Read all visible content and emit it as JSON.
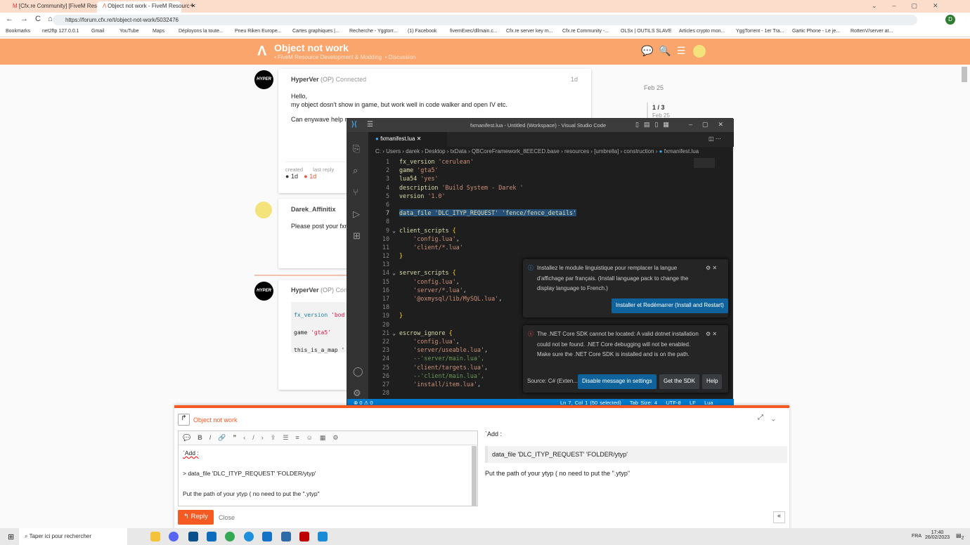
{
  "browser": {
    "tabs": [
      {
        "label": "[Cfx.re Community] [FiveM Resou"
      },
      {
        "label": "Object not work - FiveM Resourc"
      }
    ],
    "url": "https://forum.cfx.re/t/object-not-work/5032476",
    "bookmarks": [
      "Bookmarks",
      "net2ftp 127.0.0.1",
      "Gmail",
      "YouTube",
      "Maps",
      "Déployons la toute...",
      "Pneu Riken Europe...",
      "Cartes graphiques |...",
      "Recherche - Yggtorr...",
      "(1) Facebook",
      "fivemExec/dllmain.c...",
      "Cfx.re server key m...",
      "Cfx.re Community -...",
      "OLSx | OUTILS SLAVE",
      "Articles crypto mon...",
      "YggTorrent - 1er Tra...",
      "Gartic Phone - Le je...",
      "RottenV/server at..."
    ],
    "profile_initial": "D"
  },
  "forum": {
    "title": "Object not work",
    "category": "FiveM Resource Development & Modding",
    "subcategory": "Discussion",
    "timeline": {
      "start": "Feb 25",
      "position": "1 / 3",
      "date": "Feb 25"
    },
    "posts": [
      {
        "avatar": "HYPER",
        "user": "HyperVer",
        "op": "(OP)",
        "status": "Connected",
        "age": "1d",
        "lines": [
          "Hello,",
          "my object dosn't show in game, but work well in code walker and open IV etc.",
          "Can enywave help m"
        ],
        "created_label": "created",
        "created": "1d",
        "last_reply_label": "last reply",
        "last_reply": "1d"
      },
      {
        "user": "Darek_Affinitix",
        "text": "Please post your fxm"
      },
      {
        "avatar": "HYPER",
        "user": "HyperVer",
        "op": "(OP)",
        "status": "Conn",
        "code": [
          "fx_version",
          "'bod",
          "game",
          "'gta5'",
          "this_is_a_map",
          "'"
        ]
      }
    ]
  },
  "vscode": {
    "title": "fxmanifest.lua - Untitled (Workspace) - Visual Studio Code",
    "tab": "fxmanifest.lua",
    "breadcrumb": "C: › Users › darek › Desktop › txData › QBCoreFramework_8EECED.base › resources › [umbrella] › construction › ",
    "breadcrumb_file": "fxmanifest.lua",
    "notifications": [
      {
        "text": "Installez le module linguistique pour remplacer la langue d'affichage par français. (Install language pack to change the display language to French.)",
        "button": "Installer et Redémarrer (Install and Restart)"
      },
      {
        "text": "The .NET Core SDK cannot be located: A valid dotnet installation could not be found. .NET Core debugging will not be enabled. Make sure the .NET Core SDK is installed and is on the path.",
        "source": "Source: C# (Exten...",
        "buttons": [
          "Disable message in settings",
          "Get the SDK",
          "Help"
        ]
      }
    ],
    "status": {
      "problems": "⊗ 0 ⚠ 0",
      "position": "Ln 7, Col 1 (50 selected)",
      "tab_size": "Tab Size: 4",
      "encoding": "UTF-8",
      "eol": "LF",
      "language": "Lua"
    }
  },
  "composer": {
    "reply_to": "Object not work",
    "editor_lines": [
      "`Add :",
      "> data_file 'DLC_ITYP_REQUEST' 'FOLDER/ytyp'",
      "Put the path of your ytyp ( no need to put the \".ytyp\""
    ],
    "preview": {
      "line1": "`Add :",
      "quote": "data_file 'DLC_ITYP_REQUEST' 'FOLDER/ytyp'",
      "line2": "Put the path of your ytyp ( no need to put the \".ytyp\""
    },
    "reply_button": "Reply",
    "close_button": "Close"
  },
  "taskbar": {
    "search_placeholder": "Taper ici pour rechercher",
    "lang": "FRA",
    "time": "17:40",
    "date": "26/02/2023",
    "notif_count": "2"
  }
}
